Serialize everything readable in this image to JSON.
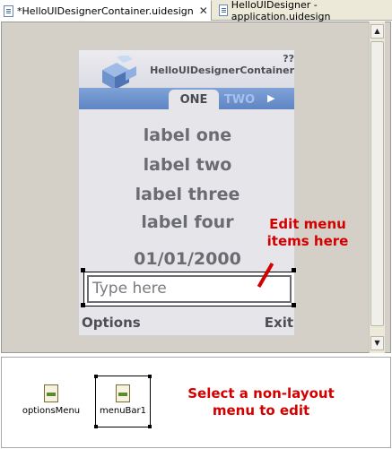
{
  "tabs": [
    {
      "label": "*HelloUIDesignerContainer.uidesign",
      "close": "✕"
    },
    {
      "label": "HelloUIDesigner - application.uidesign"
    }
  ],
  "screen": {
    "title": "??HelloUIDesignerContainer",
    "tabs": [
      "ONE",
      "TWO"
    ],
    "labels": [
      "label one",
      "label two",
      "label three",
      "label four"
    ],
    "date": "01/01/2000",
    "text_field": {
      "placeholder": "Type here",
      "value": ""
    },
    "softkeys": {
      "left": "Options",
      "right": "Exit"
    }
  },
  "annotations": {
    "edit_menu": "Edit menu items here",
    "select_menu": "Select a non-layout menu to edit"
  },
  "components": [
    {
      "label": "optionsMenu",
      "icon": "menu-component-icon"
    },
    {
      "label": "menuBar1",
      "icon": "menu-component-icon"
    }
  ],
  "colors": {
    "accent": "#d40000",
    "tabbar": "#6f93cd"
  }
}
